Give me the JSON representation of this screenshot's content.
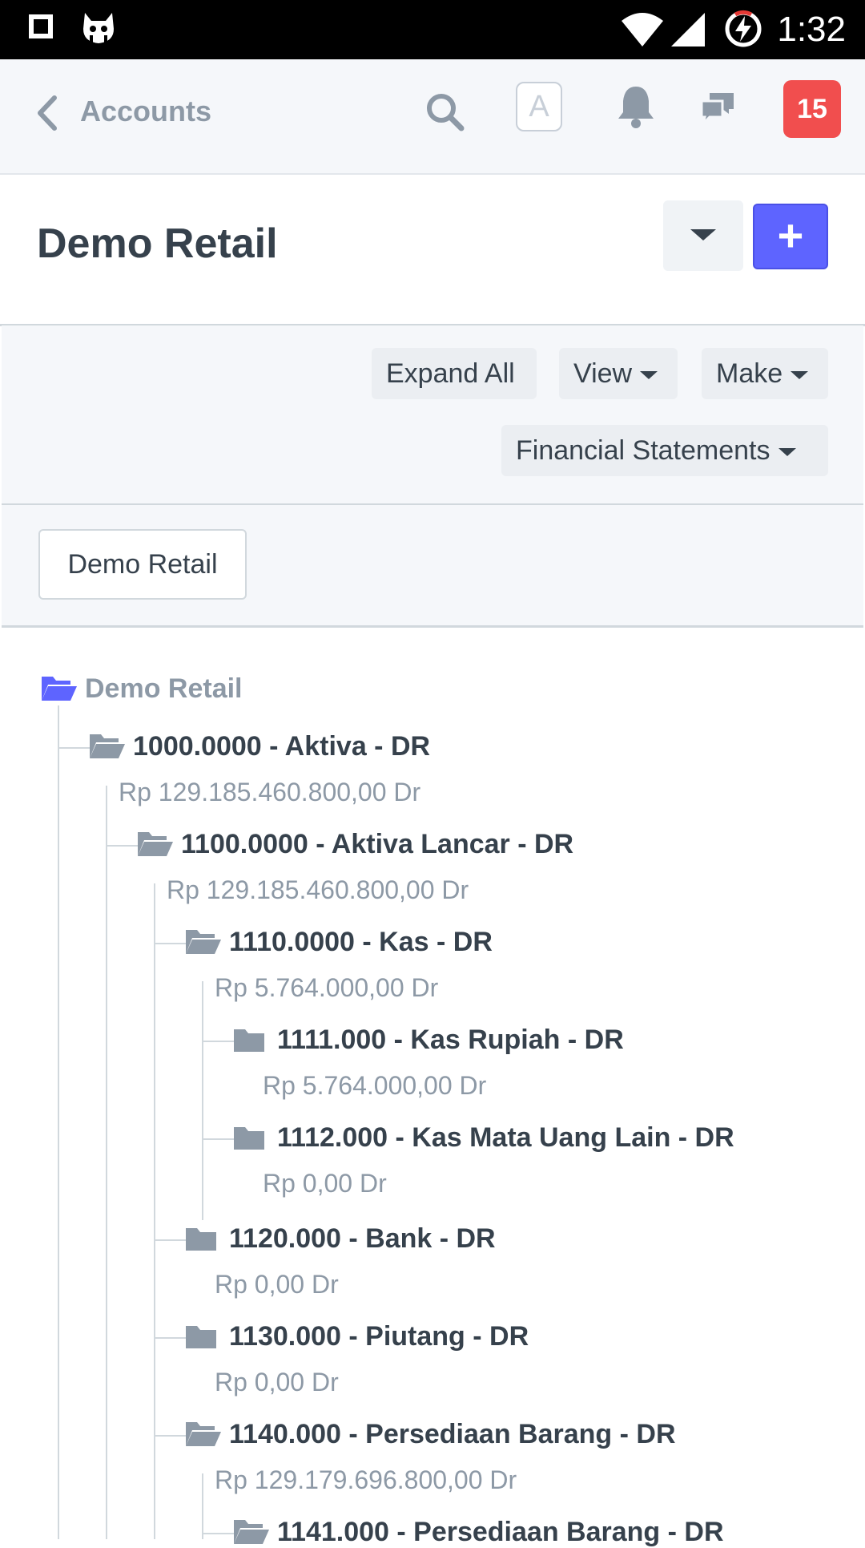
{
  "status_bar": {
    "time": "1:32"
  },
  "header": {
    "back_label": "Accounts",
    "avatar_letter": "A",
    "notification_count": "15"
  },
  "page": {
    "title": "Demo Retail",
    "add_label": "+"
  },
  "toolbar": {
    "expand_all": "Expand All",
    "view": "View",
    "make": "Make",
    "financial_statements": "Financial Statements"
  },
  "breadcrumb": {
    "company": "Demo Retail"
  },
  "tree": {
    "root": "Demo Retail",
    "nodes": [
      {
        "label": "1000.0000 - Aktiva - DR",
        "balance": "Rp 129.185.460.800,00 Dr",
        "icon": "folder-open-icon"
      },
      {
        "label": "1100.0000 - Aktiva Lancar - DR",
        "balance": "Rp 129.185.460.800,00 Dr",
        "icon": "folder-open-icon"
      },
      {
        "label": "1110.0000 - Kas - DR",
        "balance": "Rp 5.764.000,00 Dr",
        "icon": "folder-open-icon"
      },
      {
        "label": "1111.000 - Kas Rupiah - DR",
        "balance": "Rp 5.764.000,00 Dr",
        "icon": "folder-icon"
      },
      {
        "label": "1112.000 - Kas Mata Uang Lain - DR",
        "balance": "Rp 0,00 Dr",
        "icon": "folder-icon"
      },
      {
        "label": "1120.000 - Bank - DR",
        "balance": "Rp 0,00 Dr",
        "icon": "folder-icon"
      },
      {
        "label": "1130.000 - Piutang - DR",
        "balance": "Rp 0,00 Dr",
        "icon": "folder-icon"
      },
      {
        "label": "1140.000 - Persediaan Barang - DR",
        "balance": "Rp 129.179.696.800,00 Dr",
        "icon": "folder-open-icon"
      },
      {
        "label": "1141.000 - Persediaan Barang - DR",
        "balance": "",
        "icon": "folder-open-icon"
      }
    ]
  },
  "colors": {
    "accent": "#5e64ff",
    "badge": "#f14e4e",
    "muted_text": "#8d99a6",
    "text": "#36414c"
  }
}
